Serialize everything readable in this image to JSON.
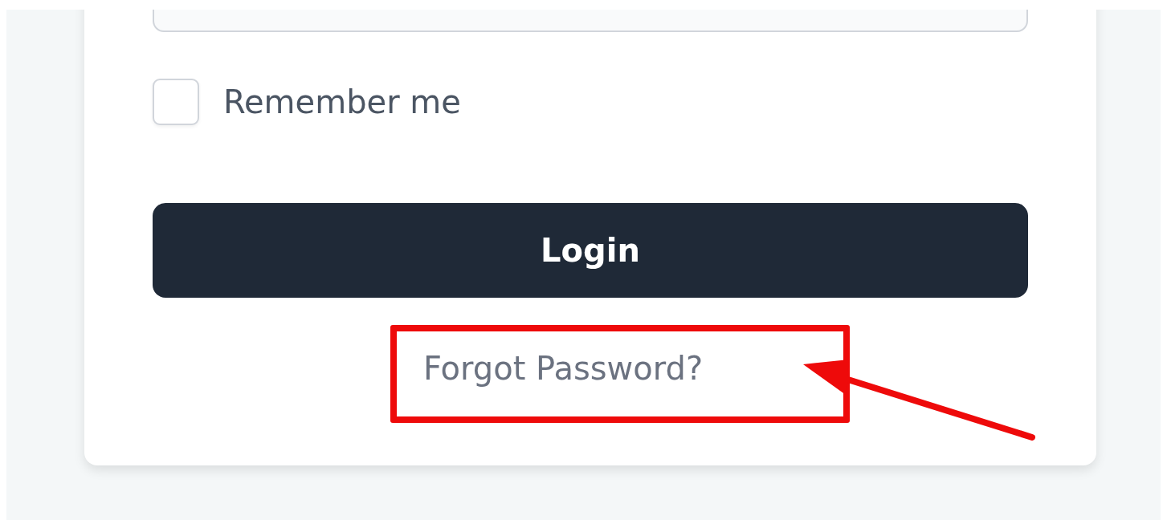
{
  "login_form": {
    "remember_me": {
      "label": "Remember me",
      "checked": false
    },
    "login_button": {
      "label": "Login"
    },
    "forgot_password": {
      "label": "Forgot Password?",
      "highlighted": true
    }
  }
}
